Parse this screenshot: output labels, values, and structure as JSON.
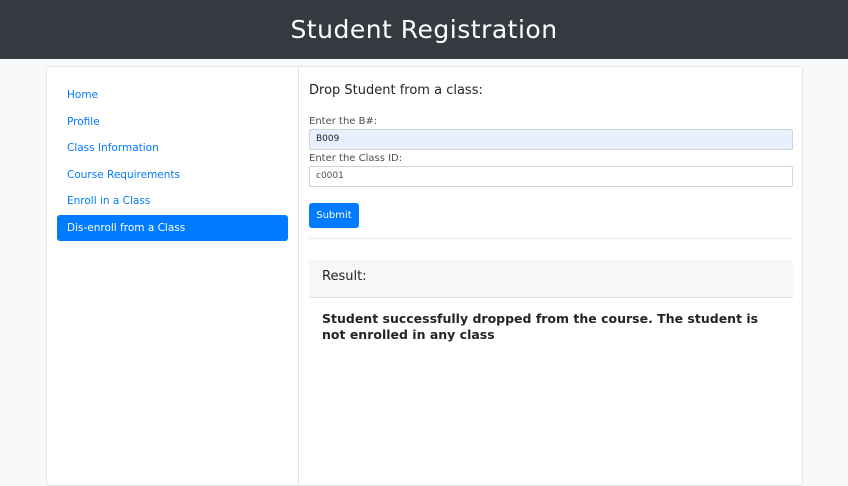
{
  "header": {
    "title": "Student Registration"
  },
  "sidebar": {
    "items": [
      {
        "label": "Home"
      },
      {
        "label": "Profile"
      },
      {
        "label": "Class Information"
      },
      {
        "label": "Course Requirements"
      },
      {
        "label": "Enroll in a Class"
      },
      {
        "label": "Dis-enroll from a Class"
      }
    ],
    "active_index": 5
  },
  "form": {
    "title": "Drop Student from a class:",
    "bnumber_label": "Enter the B#:",
    "bnumber_value": "B009",
    "classid_label": "Enter the Class ID:",
    "classid_value": "c0001",
    "submit_label": "Submit"
  },
  "result": {
    "header": "Result:",
    "message": "Student successfully dropped from the course. The student is not enrolled in any class"
  },
  "colors": {
    "topbar": "#343a40",
    "accent": "#007bff",
    "autofill": "#e8f0fe"
  }
}
